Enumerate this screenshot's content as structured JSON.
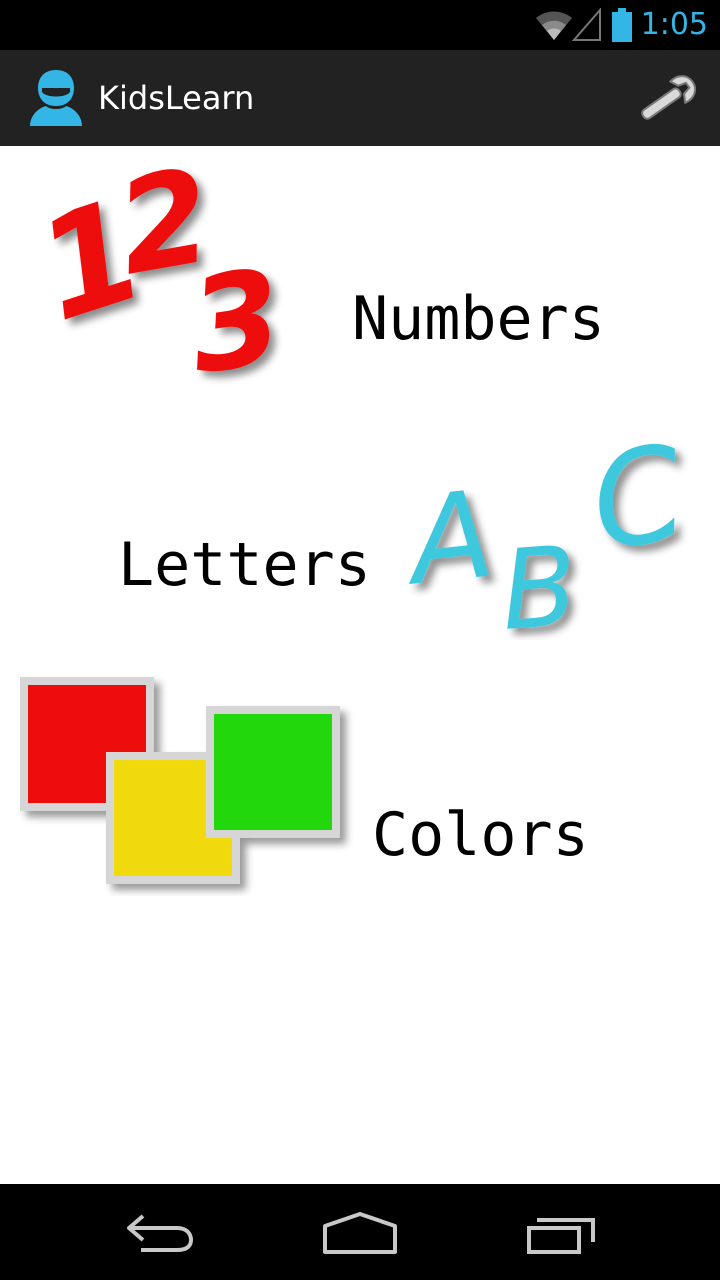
{
  "status_bar": {
    "time": "1:05",
    "accent_color": "#33b5e5",
    "icons": [
      "wifi-icon",
      "signal-icon",
      "battery-icon"
    ]
  },
  "action_bar": {
    "title": "KidsLearn",
    "app_icon": "person-icon",
    "settings_icon": "wrench-icon"
  },
  "menu": {
    "items": [
      {
        "label": "Numbers",
        "icon": "numbers-123-icon",
        "digits": [
          "1",
          "2",
          "3"
        ],
        "color": "#ee1111"
      },
      {
        "label": "Letters",
        "icon": "letters-abc-icon",
        "letters": [
          "A",
          "B",
          "C"
        ],
        "color": "#3ec8dd"
      },
      {
        "label": "Colors",
        "icon": "color-squares-icon",
        "swatches": [
          "#ee1111",
          "#f0da0a",
          "#22d811"
        ]
      }
    ]
  },
  "nav_bar": {
    "icons": [
      "back-icon",
      "home-icon",
      "recent-apps-icon"
    ]
  }
}
